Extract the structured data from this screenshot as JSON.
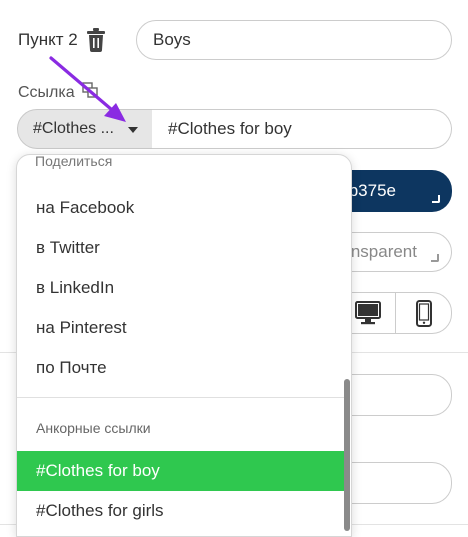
{
  "menu_item": {
    "label": "Пункт 2",
    "name_value": "Boys"
  },
  "link": {
    "label": "Ссылка",
    "select_value": "#Clothes ...",
    "input_value": "#Clothes for boy"
  },
  "background": {
    "color_value": "b375e",
    "color_hex": "#0d3660",
    "transparent_value": "nsparent"
  },
  "dropdown": {
    "top_group_label": "Поделиться",
    "share_items": [
      "на Facebook",
      "в Twitter",
      "в LinkedIn",
      "на Pinterest",
      "по Почте"
    ],
    "anchor_group_label": "Анкорные ссылки",
    "anchor_items": [
      "#Clothes for boy",
      "#Clothes for girls"
    ],
    "selected": "#Clothes for boy",
    "selected_color": "#2fc84f"
  },
  "annotation": {
    "arrow_color": "#8a2be2"
  }
}
